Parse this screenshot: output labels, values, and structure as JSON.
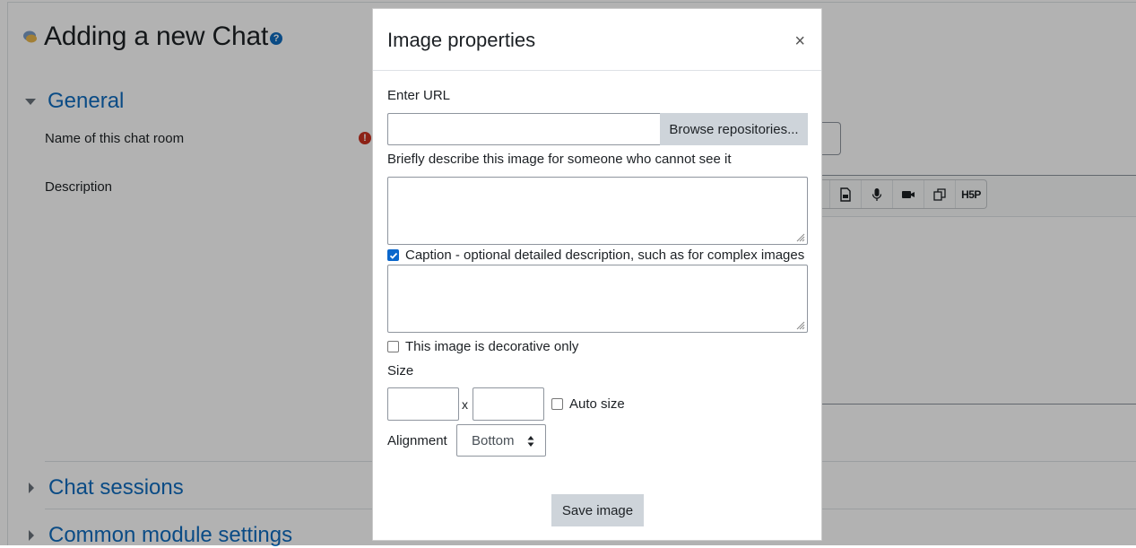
{
  "page": {
    "title": "Adding a new Chat",
    "help_glyph": "?",
    "sections": {
      "general": "General",
      "chat_sessions": "Chat sessions",
      "common_module_settings": "Common module settings"
    },
    "fields": {
      "name_label": "Name of this chat room",
      "description_label": "Description",
      "required_glyph": "!"
    },
    "toolbar": {
      "h5p_label": "H5P"
    }
  },
  "modal": {
    "title": "Image properties",
    "close_glyph": "×",
    "url_label": "Enter URL",
    "url_value": "",
    "browse_button": "Browse repositories...",
    "alt_label": "Briefly describe this image for someone who cannot see it",
    "alt_value": "",
    "caption_label": "Caption - optional detailed description, such as for complex images",
    "caption_checked": true,
    "caption_value": "",
    "decorative_label": "This image is decorative only",
    "decorative_checked": false,
    "size_label": "Size",
    "width_value": "",
    "size_separator": "x",
    "height_value": "",
    "auto_size_label": "Auto size",
    "auto_size_checked": false,
    "alignment_label": "Alignment",
    "alignment_value": "Bottom",
    "save_button": "Save image"
  },
  "colors": {
    "link_blue": "#0f6cbf",
    "required_red": "#ca3120",
    "checkbox_blue": "#0b67cc",
    "button_gray": "#ced4da"
  }
}
